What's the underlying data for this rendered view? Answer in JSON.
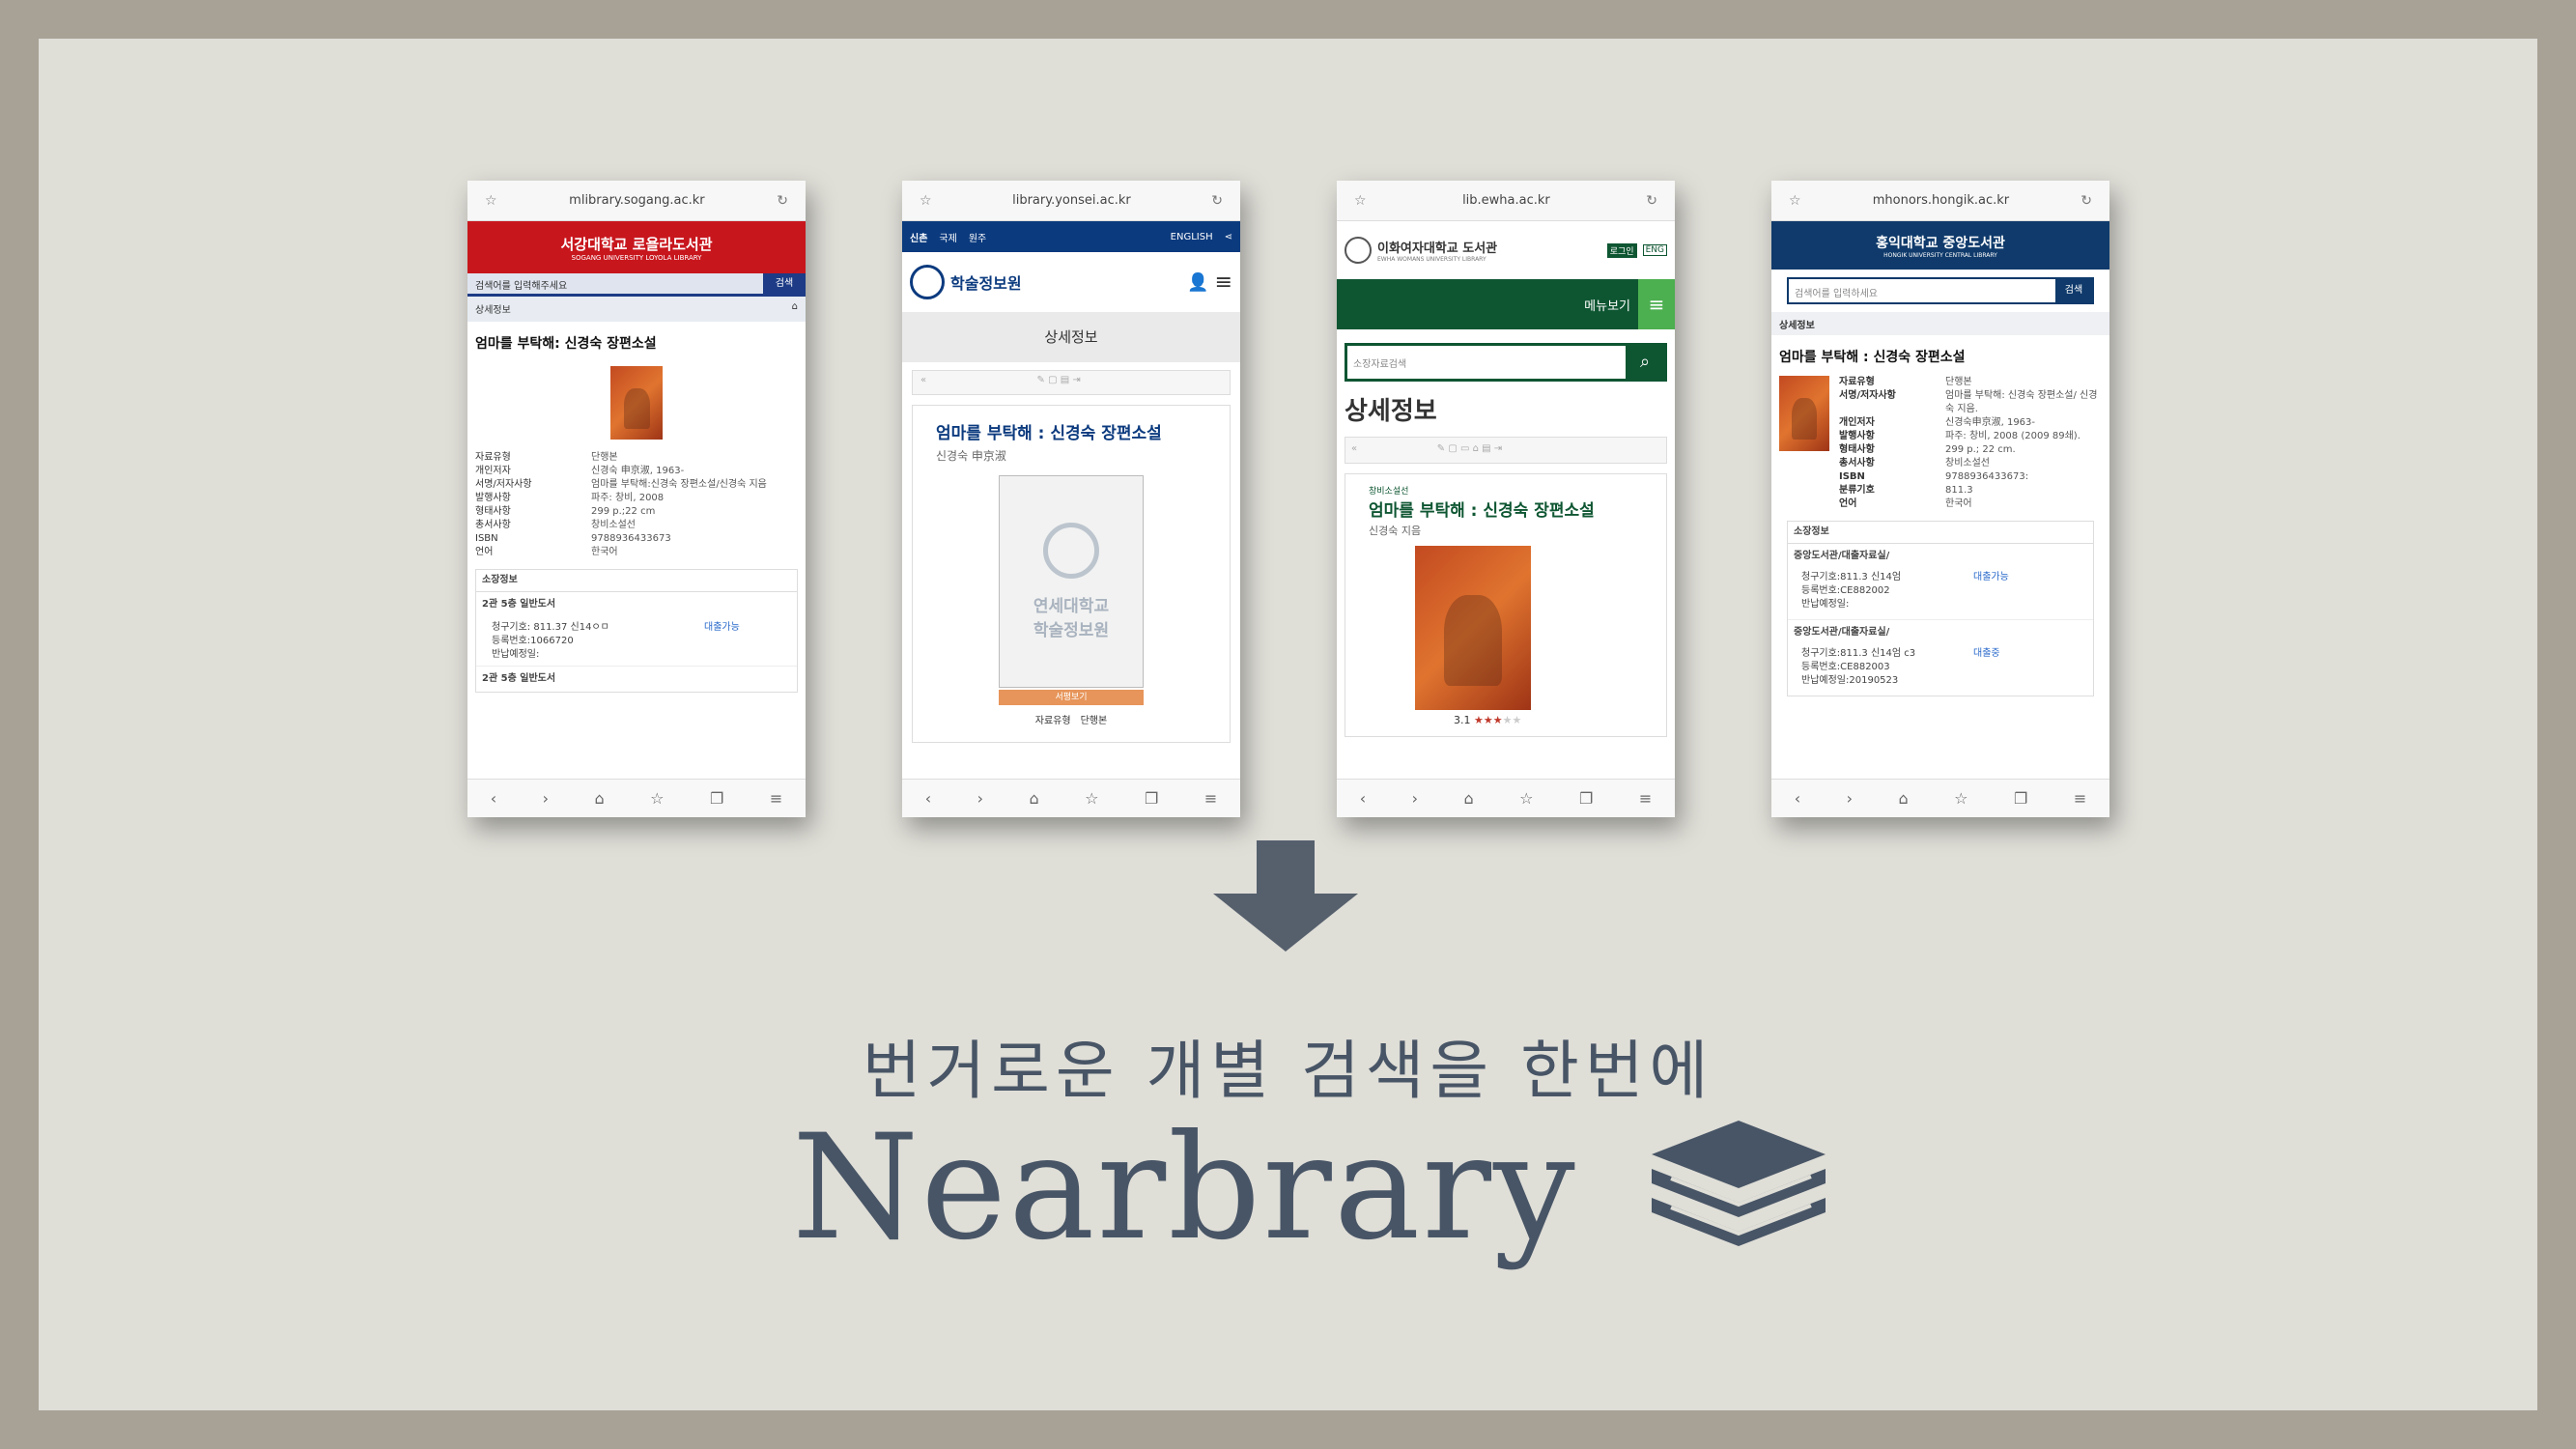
{
  "phones": [
    {
      "url": "mlibrary.sogang.ac.kr",
      "header": "서강대학교 로욜라도서관",
      "header_sub": "SOGANG UNIVERSITY LOYOLA LIBRARY",
      "search_placeholder": "검색어를 입력해주세요",
      "search_btn": "검색",
      "section": "상세정보",
      "book_title": "엄마를 부탁해: 신경숙 장편소설",
      "details": [
        [
          "자료유형",
          "단행본"
        ],
        [
          "개인저자",
          "신경숙 申京淑, 1963-"
        ],
        [
          "서명/저자사항",
          "엄마를 부탁해:신경숙 장편소설/신경숙 지음"
        ],
        [
          "발행사항",
          "파주: 창비, 2008"
        ],
        [
          "형태사항",
          "299 p.;22 cm"
        ],
        [
          "총서사항",
          "창비소설선"
        ],
        [
          "ISBN",
          "9788936433673"
        ],
        [
          "언어",
          "한국어"
        ]
      ],
      "holding_title": "소장정보",
      "loc1": "2관 5층 일반도서",
      "call": "청구기호: 811.37 신14ㅇㅁ",
      "reg": "등록번호:1066720",
      "due": "반납예정일:",
      "status": "대출가능",
      "loc2": "2관 5층 일반도서"
    },
    {
      "url": "library.yonsei.ac.kr",
      "tabs": [
        "신촌",
        "국제",
        "원주"
      ],
      "lang": "ENGLISH",
      "logo": "학술정보원",
      "section": "상세정보",
      "book_title": "엄마를 부탁해 : 신경숙 장편소설",
      "author": "신경숙 申京淑",
      "placeholder_line1": "연세대학교",
      "placeholder_line2": "학술정보원",
      "view_btn": "서평보기",
      "type_k": "자료유형",
      "type_v": "단행본"
    },
    {
      "url": "lib.ewha.ac.kr",
      "logo": "이화여자대학교 도서관",
      "logo_sub": "EWHA WOMANS UNIVERSITY LIBRARY",
      "login": "로그인",
      "eng": "ENG",
      "menu": "메뉴보기",
      "search_placeholder": "소장자료검색",
      "section": "상세정보",
      "series": "창비소설선",
      "book_title": "엄마를 부탁해 : 신경숙 장편소설",
      "author": "신경숙 지음",
      "rating": "3.1"
    },
    {
      "url": "mhonors.hongik.ac.kr",
      "logo": "홍익대학교 중앙도서관",
      "logo_sub": "HONGIK UNIVERSITY CENTRAL LIBRARY",
      "search_placeholder": "검색어를 입력하세요",
      "search_btn": "검색",
      "section": "상세정보",
      "book_title": "엄마를 부탁해 : 신경숙 장편소설",
      "details": [
        [
          "자료유형",
          "단행본"
        ],
        [
          "서명/저자사항",
          "엄마를 부탁해: 신경숙 장편소설/ 신경숙 지음."
        ],
        [
          "개인저자",
          "신경숙申京淑, 1963-"
        ],
        [
          "발행사항",
          "파주: 창비, 2008 (2009 89쇄)."
        ],
        [
          "형태사항",
          "299 p.; 22 cm."
        ],
        [
          "총서사항",
          "창비소설선"
        ],
        [
          "ISBN",
          "9788936433673:"
        ],
        [
          "분류기호",
          "811.3"
        ],
        [
          "언어",
          "한국어"
        ]
      ],
      "holding_title": "소장정보",
      "loc1": "중앙도서관/대출자료실/",
      "call1": "청구기호:811.3 신14엄",
      "reg1": "등록번호:CE882002",
      "due1": "반납예정일:",
      "status1": "대출가능",
      "loc2": "중앙도서관/대출자료실/",
      "call2": "청구기호:811.3 신14엄 c3",
      "reg2": "등록번호:CE882003",
      "due2": "반납예정일:20190523",
      "status2": "대출중"
    }
  ],
  "headline": "번거로운 개별 검색을 한번에",
  "brand": "Nearbrary",
  "colors": {
    "sogang": "#c8161d",
    "yonsei": "#0b3a7e",
    "ewha": "#0e5632",
    "hongik": "#0f3a6b",
    "text": "#485566"
  }
}
